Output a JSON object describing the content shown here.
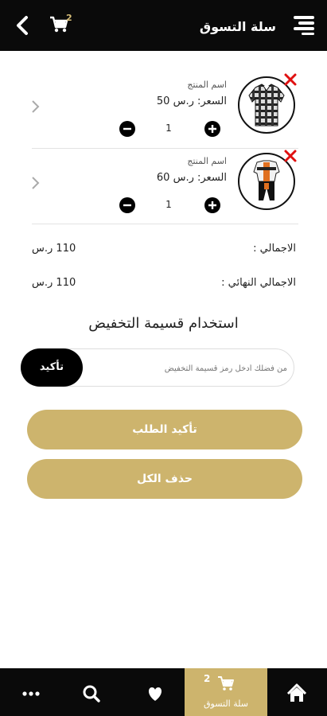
{
  "header": {
    "title": "سلة التسوق",
    "cart_badge": "2"
  },
  "cart": {
    "items": [
      {
        "name": "اسم المنتج",
        "price": "السعر: ر.س 50",
        "quantity": "1",
        "image": "plaid-shirt"
      },
      {
        "name": "اسم المنتج",
        "price": "السعر: ر.س 60",
        "quantity": "1",
        "image": "cycling-kit"
      }
    ]
  },
  "summary": {
    "total_label": "الاجمالي :",
    "total_value": "110 ر.س",
    "final_label": "الاجمالي النهائي :",
    "final_value": "110 ر.س"
  },
  "discount": {
    "title": "استخدام قسيمة التخفيض",
    "placeholder": "من فضلك أدخل رمز قسيمة التخفيض",
    "confirm_label": "تأكيد"
  },
  "actions": {
    "confirm_order": "تأكيد الطلب",
    "delete_all": "حذف الكل"
  },
  "bottom_nav": {
    "cart_label": "سلة التسوق",
    "cart_count": "2"
  },
  "colors": {
    "gold": "#cdb46d",
    "bar": "#0a0a0a",
    "remove": "#e01010"
  }
}
